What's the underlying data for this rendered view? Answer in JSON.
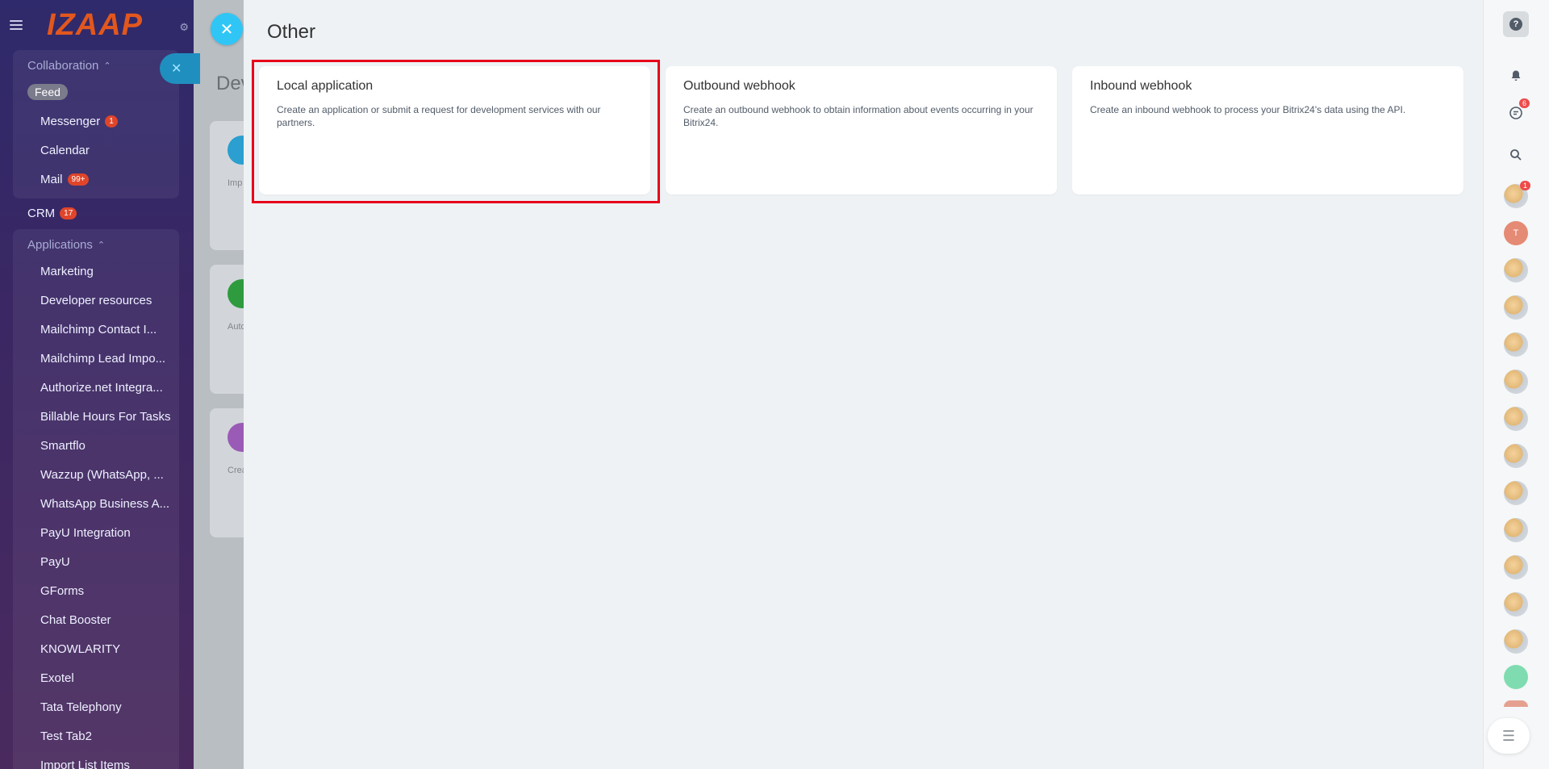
{
  "sidebar": {
    "logo": "IZAAP",
    "collaboration": {
      "title": "Collaboration",
      "items": [
        {
          "label": "Feed"
        },
        {
          "label": "Messenger",
          "badge": "1"
        },
        {
          "label": "Calendar"
        },
        {
          "label": "Mail",
          "badge": "99+"
        }
      ]
    },
    "crm": {
      "label": "CRM",
      "badge": "17"
    },
    "applications": {
      "title": "Applications",
      "items": [
        "Marketing",
        "Developer resources",
        "Mailchimp Contact I...",
        "Mailchimp Lead Impo...",
        "Authorize.net Integra...",
        "Billable Hours For Tasks",
        "Smartflo",
        "Wazzup (WhatsApp, ...",
        "WhatsApp Business A...",
        "PayU Integration",
        "PayU",
        "GForms",
        "Chat Booster",
        "KNOWLARITY",
        "Exotel",
        "Tata Telephony",
        "Test Tab2",
        "Import List Items"
      ]
    }
  },
  "background_page": {
    "title": "Dev",
    "cards": [
      "Imp you",
      "Autc man",
      "Crea"
    ]
  },
  "panel": {
    "title": "Other",
    "cards": [
      {
        "title": "Local application",
        "desc": "Create an application or submit a request for development services with our partners."
      },
      {
        "title": "Outbound webhook",
        "desc": "Create an outbound webhook to obtain information about events occurring in your Bitrix24."
      },
      {
        "title": "Inbound webhook",
        "desc": "Create an inbound webhook to process your Bitrix24's data using the API."
      }
    ]
  },
  "rail": {
    "help": "?",
    "chat_badge": "6",
    "avatar_badge": "1",
    "avatar_initial": "T"
  },
  "colors": {
    "highlight": "#e8001c",
    "close_button": "#2fc6f6",
    "badge": "#e0452a"
  }
}
